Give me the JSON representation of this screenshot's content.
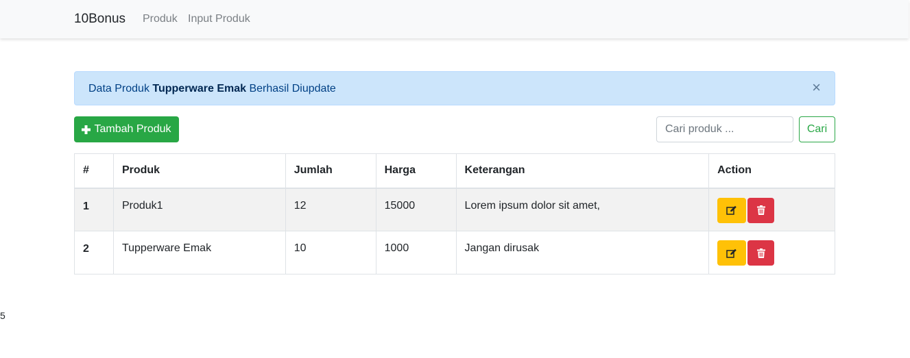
{
  "navbar": {
    "brand": "10Bonus",
    "links": [
      "Produk",
      "Input Produk"
    ]
  },
  "alert": {
    "prefix": "Data Produk",
    "product": "Tupperware Emak",
    "suffix": "Berhasil Diupdate",
    "close": "×"
  },
  "toolbar": {
    "add_label": "Tambah Produk",
    "search_placeholder": "Cari produk ...",
    "search_button": "Cari"
  },
  "table": {
    "headers": [
      "#",
      "Produk",
      "Jumlah",
      "Harga",
      "Keterangan",
      "Action"
    ],
    "rows": [
      {
        "num": "1",
        "produk": "Produk1",
        "jumlah": "12",
        "harga": "15000",
        "keterangan": "Lorem ipsum dolor sit amet,"
      },
      {
        "num": "2",
        "produk": "Tupperware Emak",
        "jumlah": "10",
        "harga": "1000",
        "keterangan": "Jangan dirusak"
      }
    ]
  },
  "footer": {
    "text": "5"
  },
  "colors": {
    "success": "#28a745",
    "warning": "#ffc107",
    "danger": "#dc3545",
    "alert_bg": "#cce5fb"
  },
  "icons": {
    "add": "plus-icon",
    "edit": "edit-icon",
    "delete": "trash-icon",
    "close": "close-icon"
  }
}
